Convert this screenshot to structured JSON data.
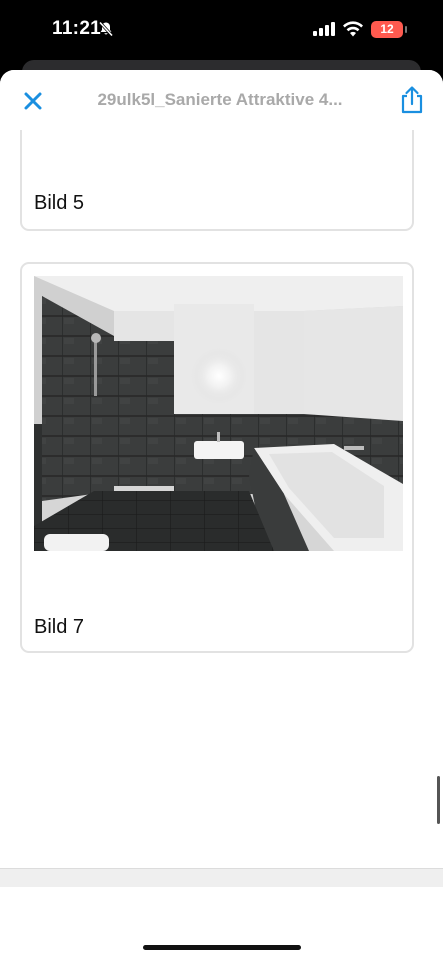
{
  "status_bar": {
    "time": "11:21",
    "battery": "12",
    "icons": [
      "bell-slash-icon",
      "signal-icon",
      "wifi-icon",
      "battery-icon"
    ]
  },
  "header": {
    "title": "29ulk5l_Sanierte Attraktive 4...",
    "close_icon": "close-icon",
    "share_icon": "share-icon",
    "accent_color": "#1a8fe0"
  },
  "pages": [
    {
      "label": "Bild 5"
    },
    {
      "label": "Bild 7",
      "image": "bathroom-photo"
    }
  ]
}
